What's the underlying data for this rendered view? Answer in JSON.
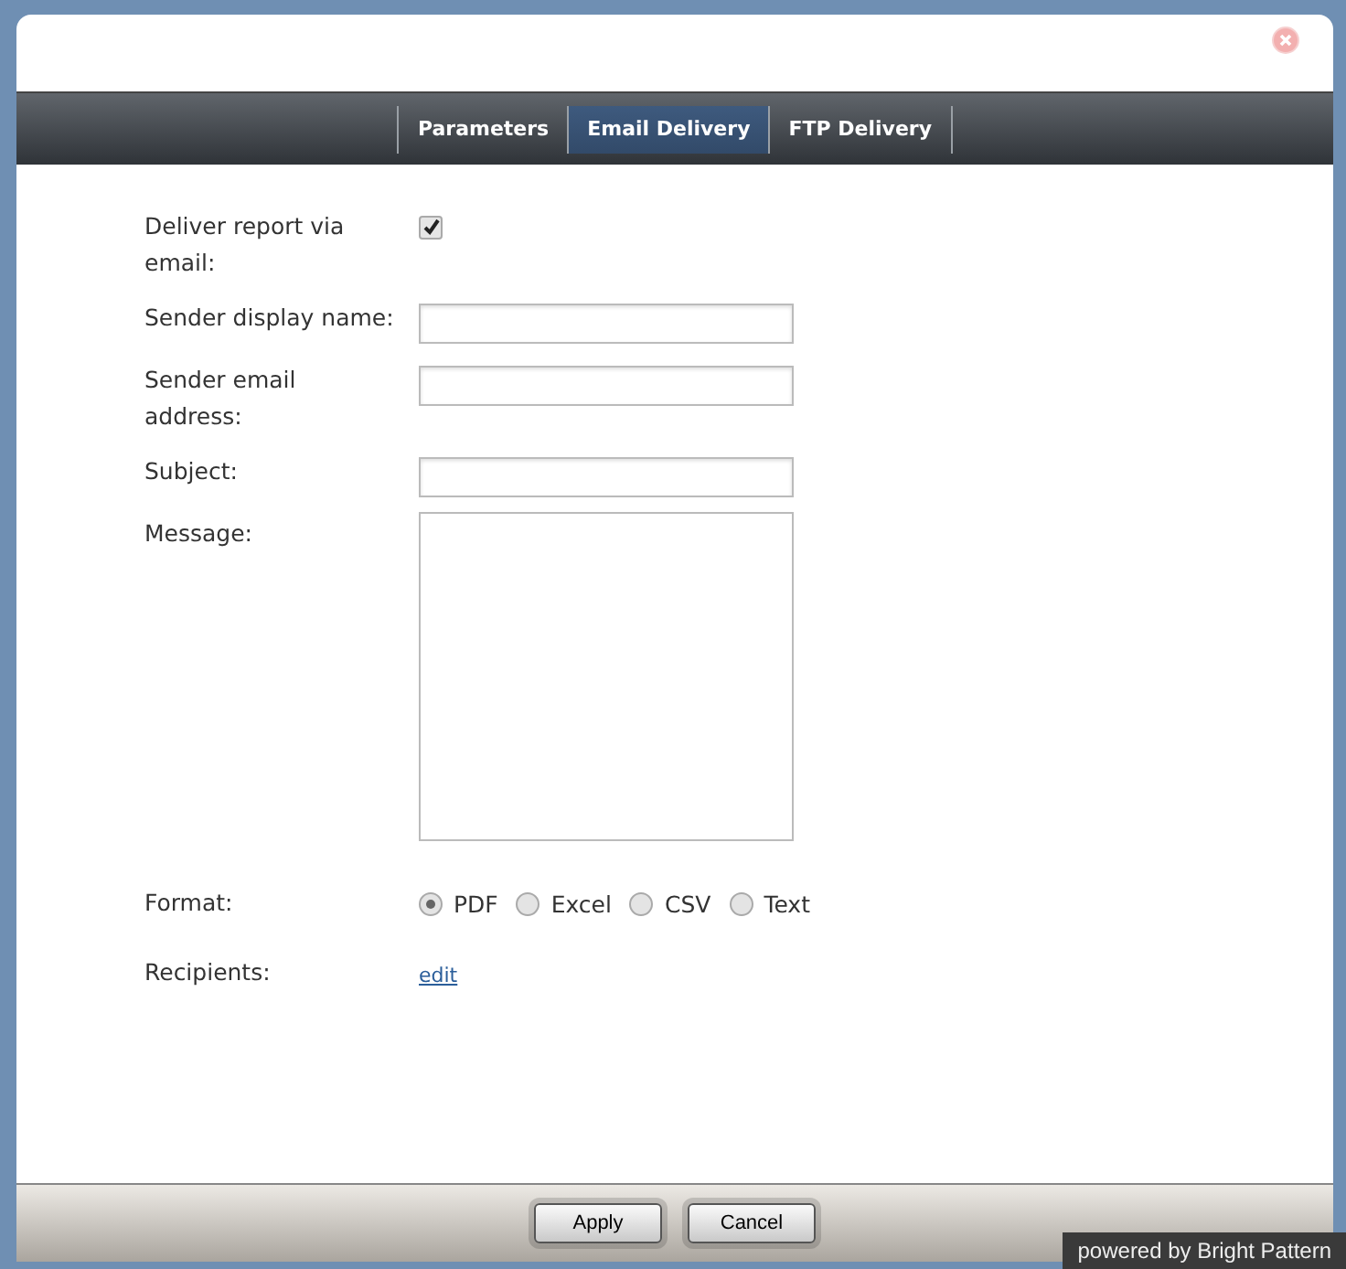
{
  "tabs": [
    {
      "label": "Parameters",
      "selected": false
    },
    {
      "label": "Email Delivery",
      "selected": true
    },
    {
      "label": "FTP Delivery",
      "selected": false
    }
  ],
  "form": [
    {
      "kind": "checkbox",
      "label": "Deliver report via email:",
      "checked": true
    },
    {
      "kind": "text",
      "label": "Sender display name:"
    },
    {
      "kind": "text",
      "label": "Sender email address:"
    },
    {
      "kind": "text",
      "label": "Subject:"
    },
    {
      "kind": "textarea",
      "label": "Message:"
    },
    {
      "kind": "radio",
      "label": "Format:",
      "options": [
        {
          "label": "PDF",
          "selected": true
        },
        {
          "label": "Excel",
          "selected": false
        },
        {
          "label": "CSV",
          "selected": false
        },
        {
          "label": "Text",
          "selected": false
        }
      ]
    },
    {
      "kind": "link",
      "label": "Recipients:",
      "link": "edit"
    }
  ],
  "buttons": [
    "Apply",
    "Cancel"
  ],
  "footer_note": "powered by Bright Pattern"
}
